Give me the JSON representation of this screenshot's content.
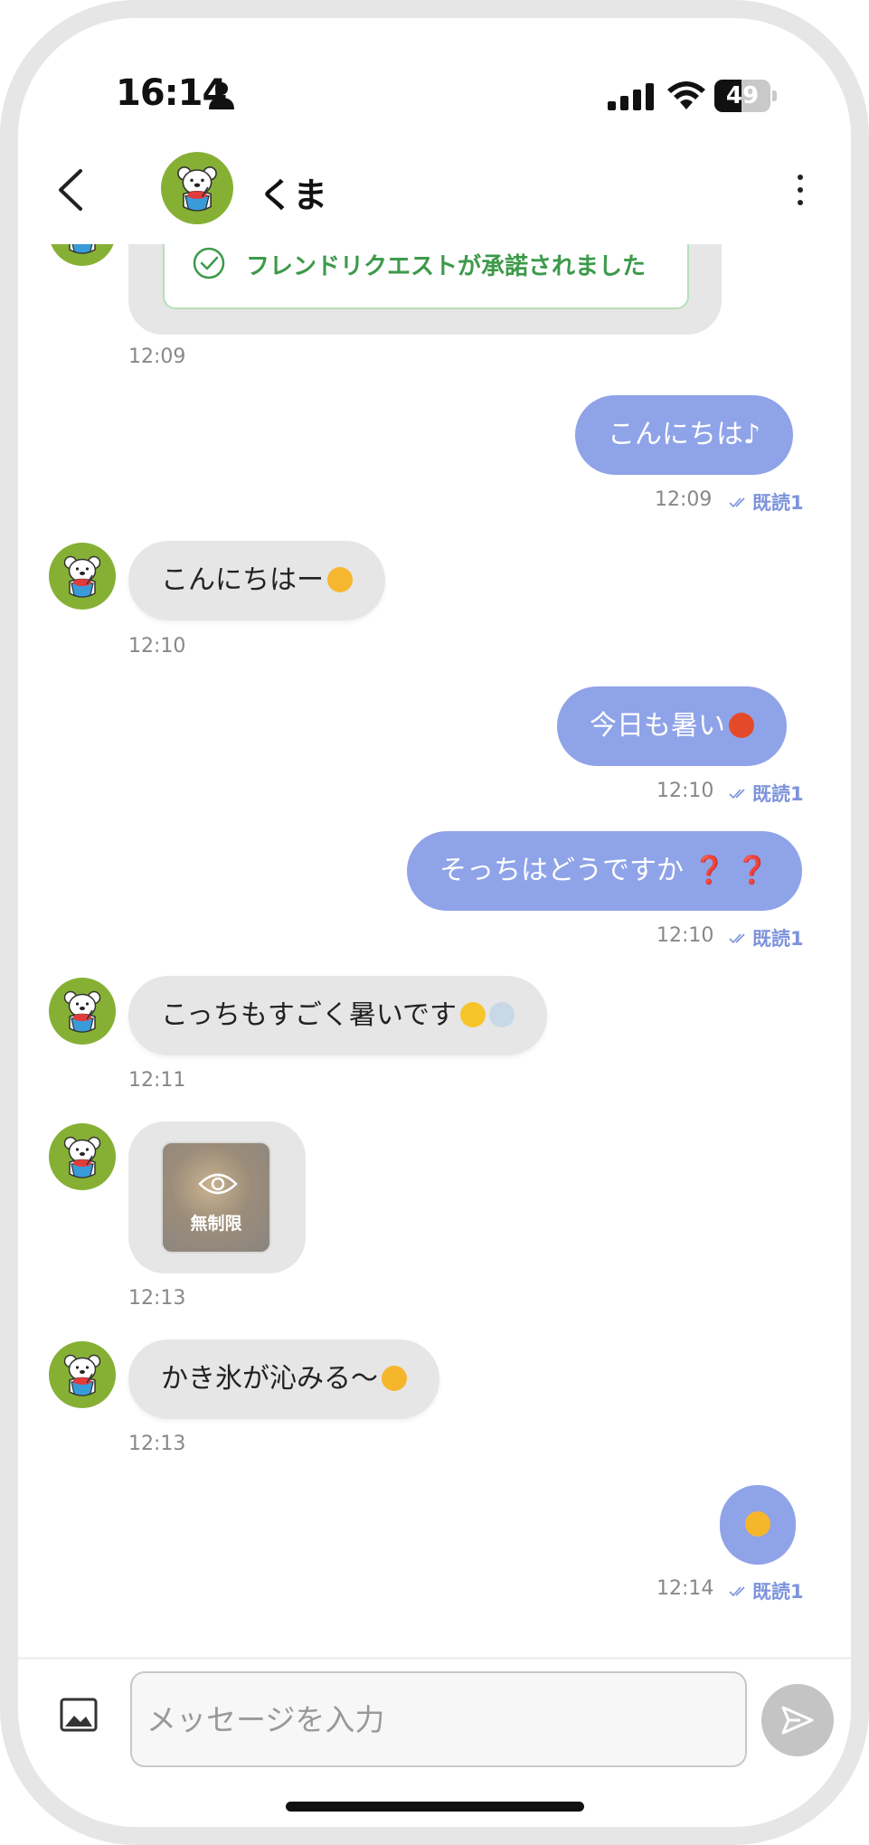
{
  "status_bar": {
    "time": "16:14",
    "battery": "49",
    "battery_level": 0.49,
    "icons": [
      "person-icon",
      "signal-icon",
      "wifi-icon",
      "battery-icon"
    ]
  },
  "header": {
    "title": "くま",
    "icons": [
      "back-arrow-icon",
      "bear-avatar-icon",
      "more-vertical-icon"
    ]
  },
  "friend_request": {
    "text": "フレンドリクエストが承諾されました",
    "time": "12:09",
    "icon": "check-circle-icon"
  },
  "messages": [
    {
      "direction": "out",
      "text": "こんにちは♪",
      "time": "12:09",
      "read": "既読1"
    },
    {
      "direction": "in",
      "text": "こんにちはー",
      "emoji": "drooling-face",
      "time": "12:10"
    },
    {
      "direction": "out",
      "text": "今日も暑い",
      "emoji": "hot-face",
      "time": "12:10",
      "read": "既読1"
    },
    {
      "direction": "out",
      "text": "そっちはどうですか",
      "marks": "❓ ❓",
      "time": "12:10",
      "read": "既読1"
    },
    {
      "direction": "in",
      "text": "こっちもすごく暑いです",
      "emoji": "sun shaved-ice",
      "time": "12:11"
    },
    {
      "direction": "in",
      "type": "image",
      "label": "無制限",
      "time": "12:13",
      "icon": "eye-icon"
    },
    {
      "direction": "in",
      "text": "かき氷が沁みる～",
      "emoji": "crying-face",
      "time": "12:13"
    },
    {
      "direction": "out",
      "emoji": "laughing-tears-face",
      "time": "12:14",
      "read": "既読1"
    }
  ],
  "input": {
    "placeholder": "メッセージを入力",
    "icons": [
      "image-icon",
      "send-icon"
    ]
  },
  "colors": {
    "outgoing_bubble": "#8fa3e8",
    "incoming_bubble": "#e6e6e6",
    "avatar_bg": "#86b034",
    "read_receipt": "#7d93dc",
    "friend_request_text": "#3d9a4a"
  }
}
